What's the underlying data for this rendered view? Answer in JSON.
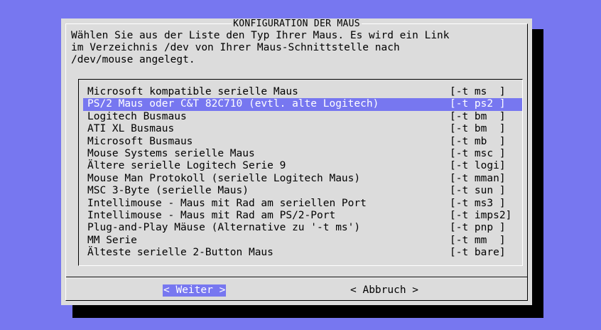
{
  "colors": {
    "desktop": "#7777f0",
    "dialog": "#dcdcdc",
    "shadow": "#000000",
    "highlight": "#7777f0",
    "highlight_text": "#ffffff"
  },
  "dialog": {
    "title": "KONFIGURATION DER MAUS",
    "prompt_lines": [
      "Wählen Sie aus der Liste den Typ Ihrer Maus. Es wird ein Link",
      "im Verzeichnis /dev von Ihrer Maus-Schnittstelle nach",
      "/dev/mouse angelegt."
    ]
  },
  "list": {
    "selected_index": 1,
    "items": [
      {
        "label": "Microsoft kompatible serielle Maus",
        "tag": "[-t ms  ]"
      },
      {
        "label": "PS/2 Maus oder C&T 82C710 (evtl. alte Logitech)",
        "tag": "[-t ps2 ]"
      },
      {
        "label": "Logitech Busmaus",
        "tag": "[-t bm  ]"
      },
      {
        "label": "ATI XL Busmaus",
        "tag": "[-t bm  ]"
      },
      {
        "label": "Microsoft Busmaus",
        "tag": "[-t mb  ]"
      },
      {
        "label": "Mouse Systems serielle Maus",
        "tag": "[-t msc ]"
      },
      {
        "label": "Ältere serielle Logitech Serie 9",
        "tag": "[-t logi]"
      },
      {
        "label": "Mouse Man Protokoll (serielle Logitech Maus)",
        "tag": "[-t mman]"
      },
      {
        "label": "MSC 3-Byte (serielle Maus)",
        "tag": "[-t sun ]"
      },
      {
        "label": "Intellimouse - Maus mit Rad am seriellen Port",
        "tag": "[-t ms3 ]"
      },
      {
        "label": "Intellimouse - Maus mit Rad am PS/2-Port",
        "tag": "[-t imps2]"
      },
      {
        "label": "Plug-and-Play Mäuse (Alternative zu '-t ms')",
        "tag": "[-t pnp ]"
      },
      {
        "label": "MM Serie",
        "tag": "[-t mm  ]"
      },
      {
        "label": "Älteste serielle 2-Button Maus",
        "tag": "[-t bare]"
      }
    ]
  },
  "buttons": {
    "next_label": "< Weiter >",
    "cancel_label": "< Abbruch >"
  }
}
